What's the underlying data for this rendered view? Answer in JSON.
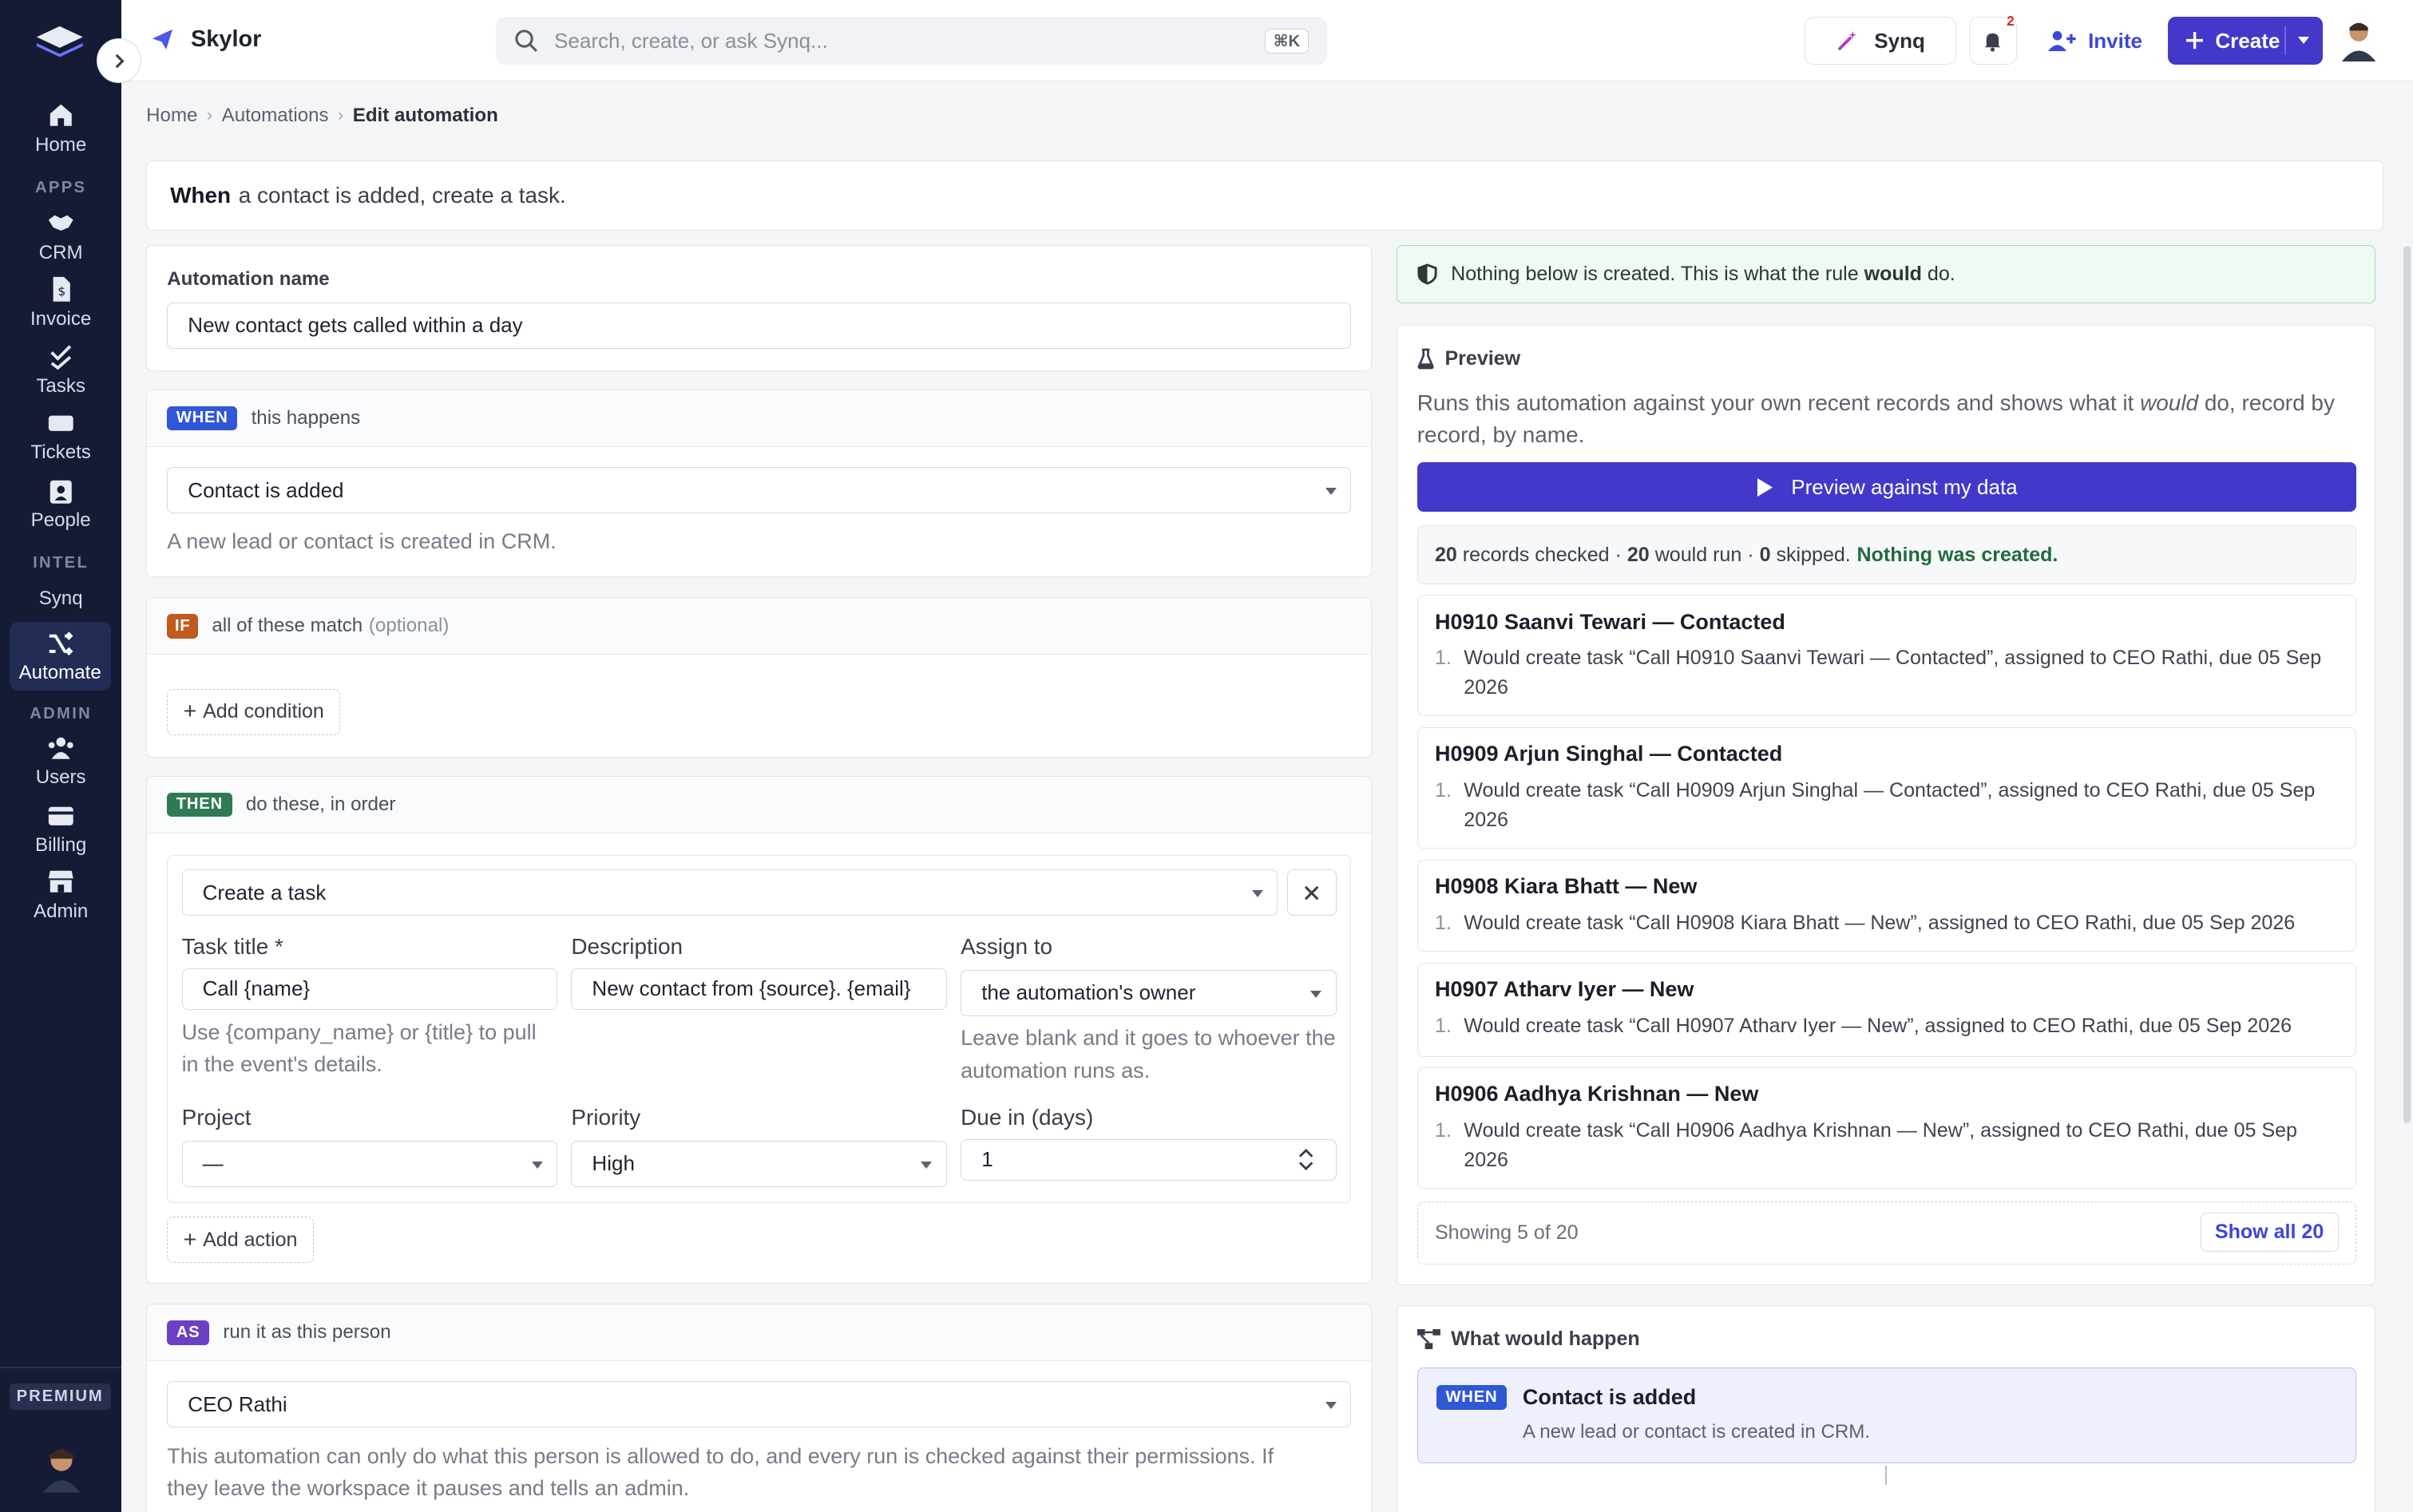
{
  "app": {
    "brand": "Skylor"
  },
  "rail": {
    "items": [
      {
        "label": "Home",
        "icon": "home-icon"
      },
      {
        "label": "CRM",
        "icon": "handshake-icon"
      },
      {
        "label": "Invoice",
        "icon": "invoice-icon"
      },
      {
        "label": "Tasks",
        "icon": "check-icon"
      },
      {
        "label": "Tickets",
        "icon": "ticket-icon"
      },
      {
        "label": "People",
        "icon": "people-icon"
      },
      {
        "label": "Synq",
        "icon": ""
      },
      {
        "label": "Automate",
        "icon": "shuffle-icon"
      },
      {
        "label": "Users",
        "icon": "users-icon"
      },
      {
        "label": "Billing",
        "icon": "card-icon"
      },
      {
        "label": "Admin",
        "icon": "store-icon"
      }
    ],
    "sections": {
      "apps": "APPS",
      "intel": "INTEL",
      "admin": "ADMIN"
    },
    "premium": "PREMIUM"
  },
  "topbar": {
    "search_placeholder": "Search, create, or ask Synq...",
    "search_kbd": "⌘K",
    "synq": "Synq",
    "notifications": "2",
    "invite": "Invite",
    "create": "Create"
  },
  "breadcrumb": {
    "home": "Home",
    "automations": "Automations",
    "current": "Edit automation"
  },
  "summary": {
    "when": "When",
    "text": "a contact is added, create a task."
  },
  "name_panel": {
    "label": "Automation name",
    "value": "New contact gets called within a day"
  },
  "when_panel": {
    "tag": "WHEN",
    "title": "this happens",
    "trigger": "Contact is added",
    "help": "A new lead or contact is created in CRM."
  },
  "if_panel": {
    "tag": "IF",
    "title": "all of these match",
    "optional": "(optional)",
    "add": "Add condition"
  },
  "then_panel": {
    "tag": "THEN",
    "title": "do these, in order",
    "action": "Create a task",
    "task_title_label": "Task title *",
    "task_title": "Call {name}",
    "task_title_help": "Use {company_name} or {title} to pull in the event's details.",
    "description_label": "Description",
    "description": "New contact from {source}. {email}",
    "assign_label": "Assign to",
    "assign": "the automation's owner",
    "assign_help": "Leave blank and it goes to whoever the automation runs as.",
    "project_label": "Project",
    "project": "—",
    "priority_label": "Priority",
    "priority": "High",
    "due_label": "Due in (days)",
    "due": "1",
    "add": "Add action"
  },
  "as_panel": {
    "tag": "AS",
    "title": "run it as this person",
    "person": "CEO Rathi",
    "help": "This automation can only do what this person is allowed to do, and every run is checked against their permissions. If they leave the workspace it pauses and tells an admin."
  },
  "notice": {
    "text": "Nothing below is created. This is what the rule",
    "bold": "would",
    "end": "do."
  },
  "preview": {
    "title": "Preview",
    "desc_1": "Runs this automation against your own recent records and shows what it",
    "desc_em": "would",
    "desc_2": "do, record by record, by name.",
    "button": "Preview against my data",
    "checked": "20",
    "checked_label": "records checked ·",
    "run": "20",
    "run_label": "would run ·",
    "skipped": "0",
    "skipped_label": "skipped.",
    "created": "Nothing was created.",
    "records": [
      {
        "title": "H0910 Saanvi Tewari — Contacted",
        "line": "Would create task “Call H0910 Saanvi Tewari — Contacted”, assigned to CEO Rathi, due 05 Sep 2026"
      },
      {
        "title": "H0909 Arjun Singhal — Contacted",
        "line": "Would create task “Call H0909 Arjun Singhal — Contacted”, assigned to CEO Rathi, due 05 Sep 2026"
      },
      {
        "title": "H0908 Kiara Bhatt — New",
        "line": "Would create task “Call H0908 Kiara Bhatt — New”, assigned to CEO Rathi, due 05 Sep 2026"
      },
      {
        "title": "H0907 Atharv Iyer — New",
        "line": "Would create task “Call H0907 Atharv Iyer — New”, assigned to CEO Rathi, due 05 Sep 2026"
      },
      {
        "title": "H0906 Aadhya Krishnan — New",
        "line": "Would create task “Call H0906 Aadhya Krishnan — New”, assigned to CEO Rathi, due 05 Sep 2026"
      }
    ],
    "showing": "Showing 5 of 20",
    "show_all": "Show all 20"
  },
  "what": {
    "title": "What would happen",
    "tag": "WHEN",
    "trigger": "Contact is added",
    "desc": "A new lead or contact is created in CRM."
  },
  "colors": {
    "accent": "#4338ca",
    "rail": "#151b35",
    "success": "#216b3c"
  }
}
